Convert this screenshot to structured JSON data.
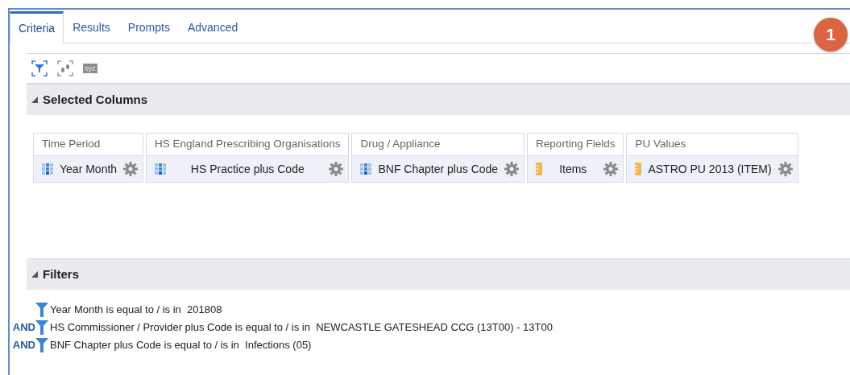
{
  "tabs": [
    {
      "label": "Criteria",
      "selected": true
    },
    {
      "label": "Results",
      "selected": false
    },
    {
      "label": "Prompts",
      "selected": false
    },
    {
      "label": "Advanced",
      "selected": false
    }
  ],
  "badge": "1",
  "toolbar": [
    {
      "kind": "filter",
      "selected": true
    },
    {
      "kind": "steps",
      "selected": false
    },
    {
      "kind": "xyz",
      "label": "xyz",
      "selected": false
    }
  ],
  "selected_columns": {
    "title": "Selected Columns",
    "expanded": true,
    "groups": [
      {
        "heading": "Time Period",
        "columns": [
          {
            "label": "Year Month",
            "kind": "attribute"
          }
        ]
      },
      {
        "heading": "HS England Prescribing Organisations",
        "columns": [
          {
            "label": "HS Practice plus Code",
            "kind": "attribute"
          }
        ]
      },
      {
        "heading": "Drug / Appliance",
        "columns": [
          {
            "label": "BNF Chapter plus Code",
            "kind": "attribute"
          }
        ]
      },
      {
        "heading": "Reporting Fields",
        "columns": [
          {
            "label": "Items",
            "kind": "measure"
          }
        ]
      },
      {
        "heading": "PU Values",
        "columns": [
          {
            "label": "ASTRO PU 2013 (ITEM)",
            "kind": "measure"
          }
        ]
      }
    ]
  },
  "filters": {
    "title": "Filters",
    "expanded": true,
    "items": [
      {
        "text": "Year Month is equal to / is in  201808"
      },
      {
        "connector": "AND",
        "text": "HS Commissioner / Provider plus Code is equal to / is in  NEWCASTLE GATESHEAD CCG (13T00) - 13T00"
      },
      {
        "connector": "AND",
        "text": "BNF Chapter plus Code is equal to / is in  Infections (05)"
      }
    ]
  }
}
